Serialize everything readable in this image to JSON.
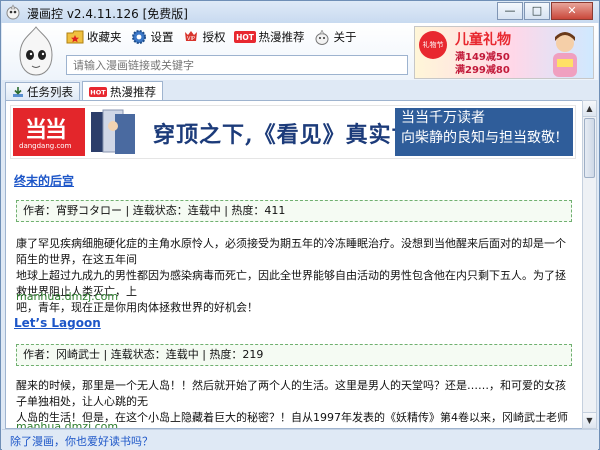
{
  "window": {
    "title": "漫画控 v2.4.11.126 [免费版]",
    "buttons": {
      "minimize": "—",
      "maximize": "□",
      "close": "✕"
    }
  },
  "toolbar": {
    "items": [
      {
        "label": "收藏夹",
        "icon": "favorites-folder-icon"
      },
      {
        "label": "设置",
        "icon": "gear-icon"
      },
      {
        "label": "授权",
        "icon": "vip-icon"
      },
      {
        "label": "热漫推荐",
        "icon": "hot-badge-icon",
        "badge": "HOT"
      },
      {
        "label": "关于",
        "icon": "about-icon"
      }
    ]
  },
  "search": {
    "placeholder": "请输入漫画链接或关键字",
    "value": ""
  },
  "header_ad": {
    "badge": "礼物节",
    "headline": "儿童礼物",
    "line1": "满149减50",
    "line2": "满299减80"
  },
  "tabs": [
    {
      "label": "任务列表",
      "icon": "download-icon",
      "active": false
    },
    {
      "label": "热漫推荐",
      "icon": "hot-badge-icon",
      "badge": "HOT",
      "active": true
    }
  ],
  "banner": {
    "logo_big": "当当",
    "logo_small": "dangdang.com",
    "slogan": "穿顶之下,《看见》真实世界",
    "right_line1": "当当千万读者",
    "right_line2": "向柴静的良知与担当致敬!"
  },
  "items": [
    {
      "title": "终末的后宫",
      "meta": "作者：宵野コタロー | 连载状态：连载中 | 热度：411",
      "desc_line1": "康了罕见疾病细胞硬化症的主角水原怜人，必须接受为期五年的冷冻睡眠治疗。没想到当他醒来后面对的却是一个陌生的世界，在这五年间",
      "desc_line2": "地球上超过九成九的男性都因为感染病毒而死亡，因此全世界能够自由活动的男性包含他在内只剩下五人。为了拯救世界阻止人类灭亡，上",
      "desc_line3": "吧，青年，现在正是你用肉体拯救世界的好机会！",
      "source": "manhua.dmzj.com"
    },
    {
      "title": "Let’s Lagoon",
      "meta": "作者：冈崎武士 | 连载状态：连载中 | 热度：219",
      "desc_line1": "醒来的时候，那里是一个无人岛！！然后就开始了两个人的生活。这里是男人的天堂吗？还是……，和可爱的女孩子单独相处，让人心跳的无",
      "desc_line2": "人岛的生活！但是，在这个小岛上隐藏着巨大的秘密？！自从1997年发表的《妖精传》第4卷以来，冈崎武士老师久违了13年的漫画。",
      "source": "manhua.dmzj.com"
    }
  ],
  "statusbar": {
    "link": "除了漫画，你也爱好读书吗？"
  },
  "colors": {
    "link_blue": "#1d56c8",
    "source_green": "#2d7d2d",
    "hot_red": "#e8282f",
    "dangdang_red": "#e3262b"
  }
}
